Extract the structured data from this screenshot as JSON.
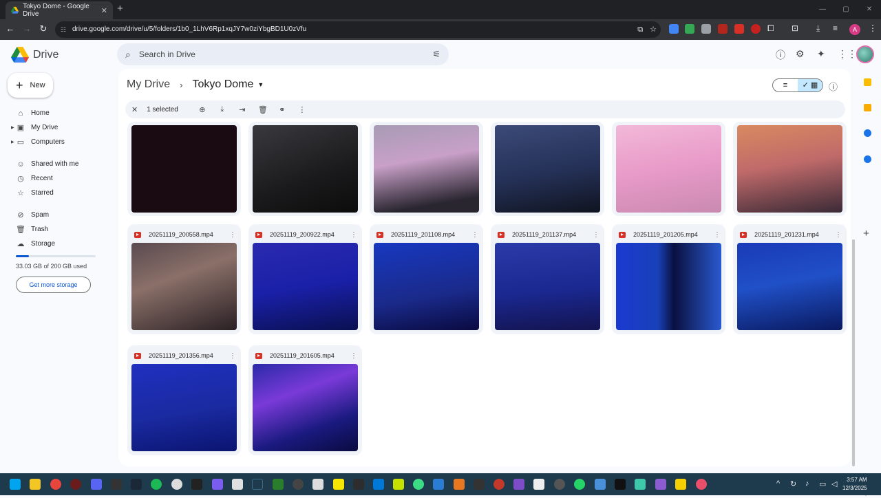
{
  "browser": {
    "tab_title": "Tokyo Dome - Google Drive",
    "tab_close": "✕",
    "new_tab": "+",
    "url": "drive.google.com/drive/u/5/folders/1b0_1LhV6Rp1xqJY7w0ziYbgBD1U0zVfu",
    "profile_initial": "A"
  },
  "drive": {
    "app_name": "Drive",
    "search_placeholder": "Search in Drive",
    "new_label": "New",
    "sidebar": [
      {
        "label": "Home",
        "icon": "home-icon"
      },
      {
        "label": "My Drive",
        "icon": "my-drive-icon"
      },
      {
        "label": "Computers",
        "icon": "computers-icon"
      },
      {
        "label": "Shared with me",
        "icon": "shared-icon"
      },
      {
        "label": "Recent",
        "icon": "clock-icon"
      },
      {
        "label": "Starred",
        "icon": "star-icon"
      },
      {
        "label": "Spam",
        "icon": "spam-icon"
      },
      {
        "label": "Trash",
        "icon": "trash-icon"
      },
      {
        "label": "Storage",
        "icon": "cloud-icon"
      }
    ],
    "storage_used_text": "33.03 GB of 200 GB used",
    "storage_fraction": 0.165,
    "get_more_storage": "Get more storage",
    "breadcrumb": {
      "parent": "My Drive",
      "current": "Tokyo Dome"
    },
    "selection_text": "1 selected",
    "files_row2": [
      "20251119_200558.mp4",
      "20251119_200922.mp4",
      "20251119_201108.mp4",
      "20251119_201137.mp4",
      "20251119_201205.mp4",
      "20251119_201231.mp4"
    ],
    "files_row3": [
      "20251119_201356.mp4",
      "20251119_201605.mp4"
    ]
  },
  "taskbar": {
    "time": "3:57 AM",
    "date": "12/3/2025"
  },
  "colors": {
    "accent": "#0b57d0",
    "toggle_active": "#c2e7ff",
    "video_icon": "#d93025"
  }
}
